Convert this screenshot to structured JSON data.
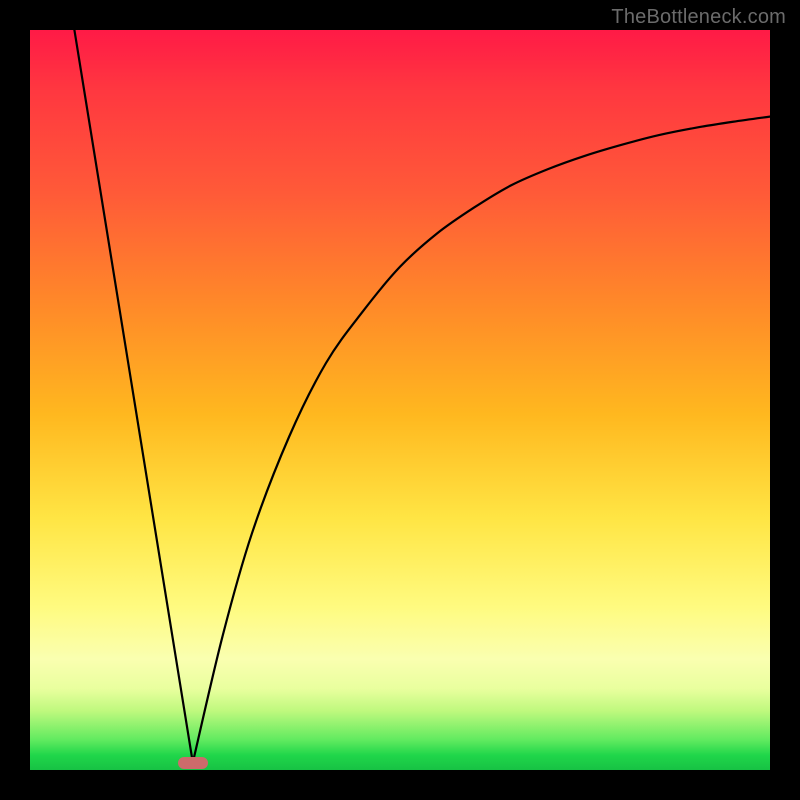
{
  "watermark": "TheBottleneck.com",
  "colors": {
    "background": "#000000",
    "curve": "#000000",
    "marker": "#cd6b6b",
    "gradient_top": "#ff1a46",
    "gradient_bottom": "#17c244"
  },
  "chart_data": {
    "type": "line",
    "title": "",
    "xlabel": "",
    "ylabel": "",
    "xlim": [
      0,
      100
    ],
    "ylim": [
      0,
      100
    ],
    "annotations": [
      {
        "kind": "marker-pill",
        "x": 22,
        "y": 1
      }
    ],
    "series": [
      {
        "name": "left-descent",
        "x": [
          6,
          22
        ],
        "values": [
          100,
          1
        ]
      },
      {
        "name": "right-curve",
        "x": [
          22,
          26,
          30,
          35,
          40,
          45,
          50,
          55,
          60,
          65,
          70,
          75,
          80,
          85,
          90,
          95,
          100
        ],
        "values": [
          1,
          18,
          32,
          45,
          55,
          62,
          68,
          72.5,
          76,
          79,
          81.2,
          83,
          84.5,
          85.8,
          86.8,
          87.6,
          88.3
        ]
      }
    ]
  }
}
